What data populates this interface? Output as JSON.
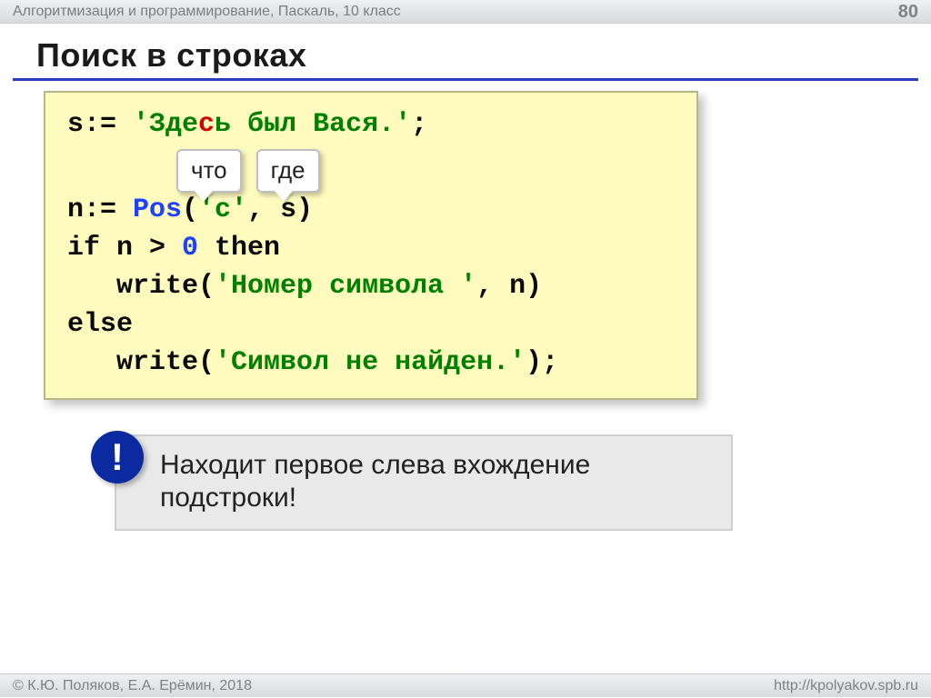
{
  "header": {
    "breadcrumb": "Алгоритмизация и программирование, Паскаль, 10 класс",
    "page_number": "80"
  },
  "title": "Поиск в строках",
  "code": {
    "line1": {
      "p1": "s:= ",
      "str_open": "'Зде",
      "str_red": "с",
      "str_rest": "ь был Вася.'",
      "p2": ";"
    },
    "labels": {
      "what": "что",
      "where": "где"
    },
    "line2": {
      "p1": "n:= ",
      "fn": "Pos",
      "p2": "(",
      "arg1": "'с'",
      "p3": ", s)"
    },
    "line3": {
      "p1": "if n > ",
      "zero": "0",
      "p2": " then"
    },
    "line4": {
      "indent": "   ",
      "p1": "write(",
      "arg": "'Номер символа '",
      "p2": ", n)"
    },
    "line5": "else",
    "line6": {
      "indent": "   ",
      "p1": "write(",
      "arg": "'Символ не найден.'",
      "p2": ");"
    }
  },
  "note": {
    "icon": "!",
    "text_line1": "Находит первое слева вхождение",
    "text_line2": "подстроки!"
  },
  "footer": {
    "left": "© К.Ю. Поляков, Е.А. Ерёмин, 2018",
    "right": "http://kpolyakov.spb.ru"
  }
}
